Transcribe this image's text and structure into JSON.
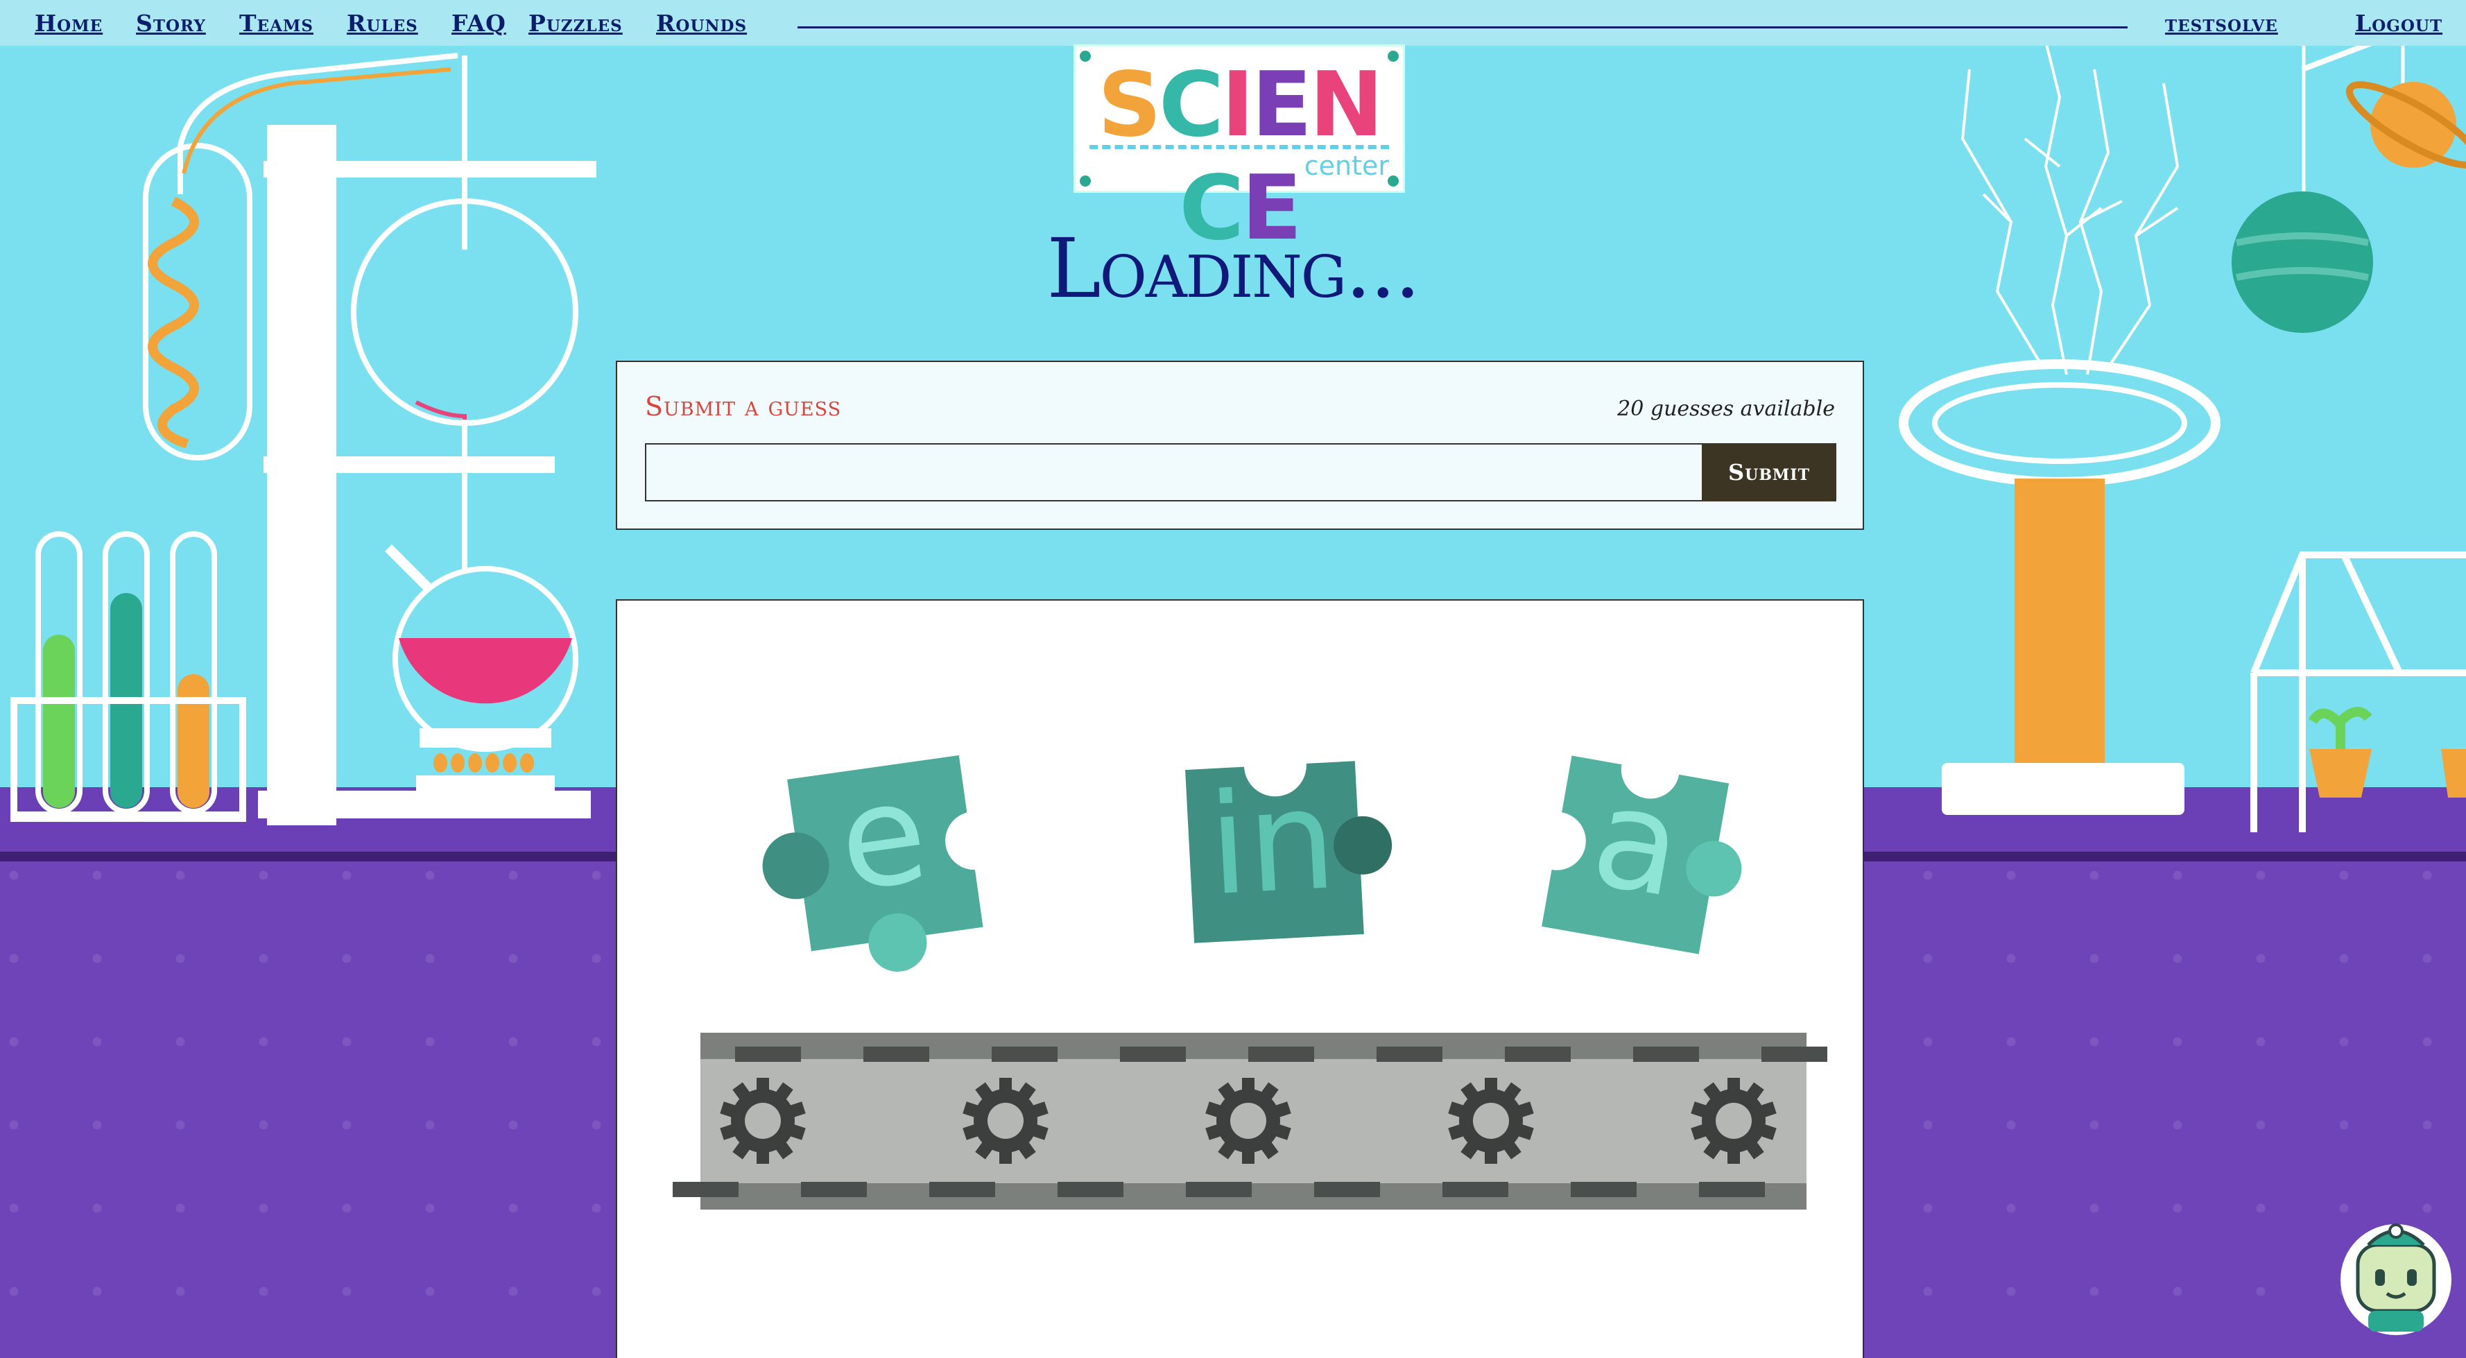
{
  "nav": {
    "links": [
      "Home",
      "Story",
      "Teams",
      "Rules",
      "FAQ",
      "Puzzles",
      "Rounds"
    ],
    "username": "testsolve",
    "logout": "Logout"
  },
  "logo": {
    "letters": [
      "S",
      "C",
      "I",
      "E",
      "N",
      "C",
      "E"
    ],
    "letter_colors": [
      "#f2a33a",
      "#35b8a8",
      "#e8437a",
      "#7a3fb5",
      "#e8437a",
      "#35b8a8",
      "#7a3fb5"
    ],
    "subtitle": "center"
  },
  "page": {
    "title": "Loading..."
  },
  "guess": {
    "heading": "Submit a guess",
    "count": "20 guesses available",
    "input_value": "",
    "submit_label": "Submit"
  },
  "puzzle": {
    "pieces": [
      "e",
      "in",
      "a"
    ],
    "piece_color": "#5cc4b0",
    "gear_count": 5
  },
  "colors": {
    "sky": "#7ae0f0",
    "nav_bg": "#a9e8f2",
    "nav_text": "#0b1d6b",
    "floor": "#6e44b8",
    "heading_red": "#d8453b",
    "button_bg": "#3d3524"
  }
}
